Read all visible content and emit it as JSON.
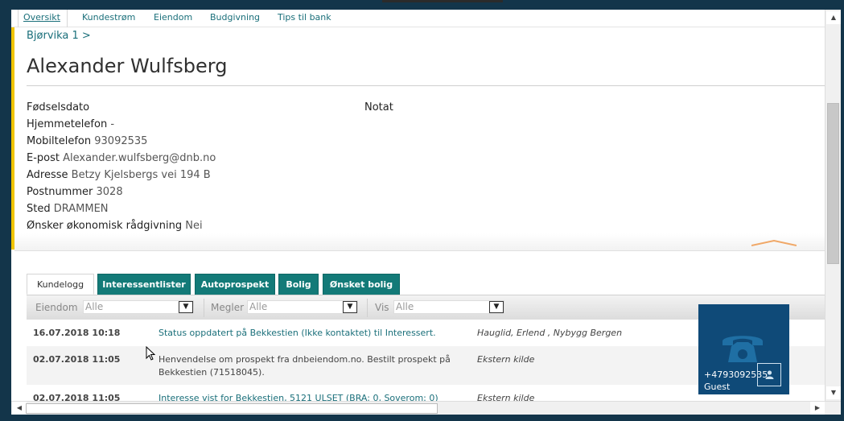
{
  "nav": {
    "items": [
      "Oversikt",
      "Kundestrøm",
      "Eiendom",
      "Budgivning",
      "Tips til bank"
    ]
  },
  "breadcrumb": "Bjørvika 1 >",
  "customer": {
    "name": "Alexander Wulfsberg",
    "fields": [
      {
        "label": "Fødselsdato",
        "value": ""
      },
      {
        "label": "Hjemmetelefon",
        "value": "-"
      },
      {
        "label": "Mobiltelefon",
        "value": "93092535"
      },
      {
        "label": "E-post",
        "value": "Alexander.wulfsberg@dnb.no"
      },
      {
        "label": "Adresse",
        "value": "Betzy Kjelsbergs vei 194 B"
      },
      {
        "label": "Postnummer",
        "value": "3028"
      },
      {
        "label": "Sted",
        "value": "DRAMMEN"
      },
      {
        "label": "Ønsker økonomisk rådgivning",
        "value": "Nei"
      }
    ],
    "notat_label": "Notat"
  },
  "tabs": [
    "Kundelogg",
    "Interessentlister",
    "Autoprospekt",
    "Bolig",
    "Ønsket bolig"
  ],
  "filters": [
    {
      "label": "Eiendom",
      "value": "Alle"
    },
    {
      "label": "Megler",
      "value": "Alle"
    },
    {
      "label": "Vis",
      "value": "Alle"
    }
  ],
  "log": [
    {
      "date": "16.07.2018 10:18",
      "text": "Status oppdatert på Bekkestien (Ikke kontaktet) til Interessert.",
      "source": "Hauglid, Erlend , Nybygg Bergen"
    },
    {
      "date": "02.07.2018 11:05",
      "text": "Henvendelse om prospekt fra dnbeiendom.no. Bestilt prospekt på Bekkestien (71518045).",
      "source": "Ekstern kilde"
    },
    {
      "date": "02.07.2018 11:05",
      "text": "Interesse vist for Bekkestien, 5121 ULSET (BRA: 0, Soverom: 0)",
      "source": "Ekstern kilde"
    }
  ],
  "phone_widget": {
    "number": "+4793092535",
    "caller": "Guest",
    "icons": [
      "phone-icon",
      "user-icon"
    ]
  },
  "colors": {
    "accent_teal": "#137a78",
    "link": "#1a6f7a",
    "highlight_yellow": "#f0c400",
    "phone_bg": "#0f4a78"
  }
}
